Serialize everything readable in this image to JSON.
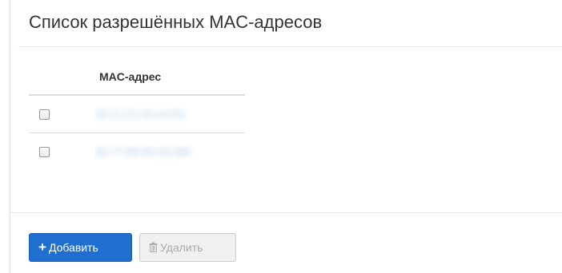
{
  "panel": {
    "title": "Список разрешённых MAC-адресов"
  },
  "table": {
    "column_header": "MAC-адрес",
    "rows": [
      {
        "checked": false,
        "mac": "00:11:22:33:44:55"
      },
      {
        "checked": false,
        "mac": "66:77:88:99:AA:BB"
      }
    ]
  },
  "actions": {
    "add_label": "Добавить",
    "add_icon": "plus-icon",
    "delete_label": "Удалить",
    "delete_icon": "trash-icon",
    "delete_disabled": true
  },
  "colors": {
    "primary_button": "#1f6fd1",
    "disabled_text": "#aaaaaa"
  }
}
